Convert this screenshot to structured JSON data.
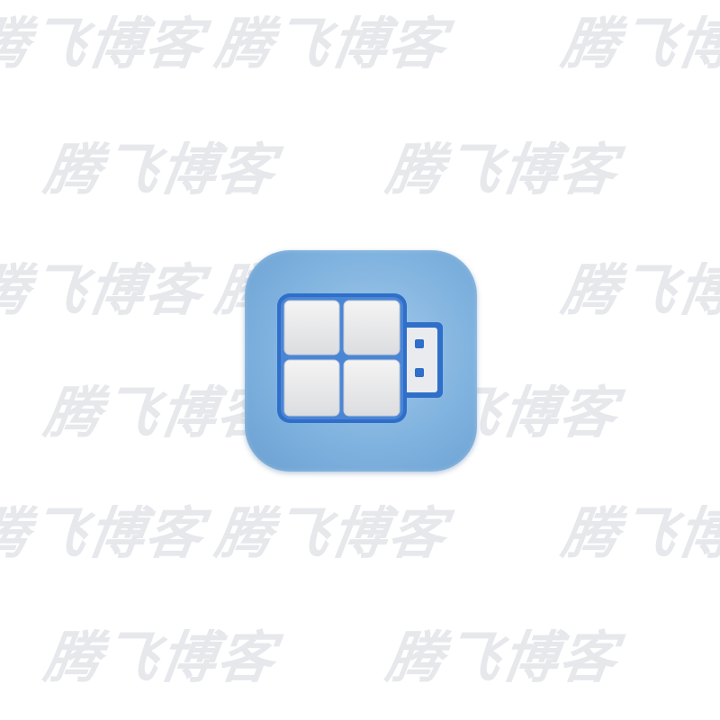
{
  "watermark": {
    "text": "腾飞博客",
    "color": "#e6e8ec"
  },
  "app_icon": {
    "name": "windows-usb-icon",
    "colors": {
      "background": "#80b3df",
      "frame": "#2f6fc9",
      "tile": "#ececec",
      "connector": "#e9ebee"
    }
  }
}
